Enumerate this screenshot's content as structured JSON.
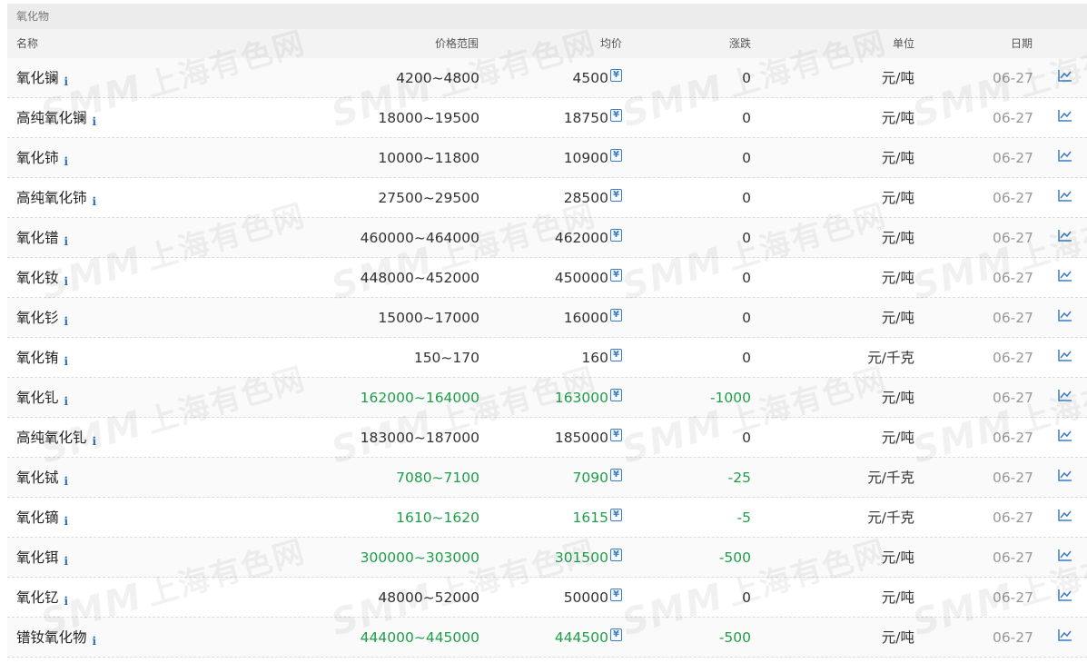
{
  "section_title": "氧化物",
  "columns": {
    "name": "名称",
    "range": "价格范围",
    "avg": "均价",
    "change": "涨跌",
    "unit": "单位",
    "date": "日期"
  },
  "icons": {
    "info": "info-icon",
    "avg": "yuan-calendar-icon",
    "chart": "line-chart-icon"
  },
  "colors": {
    "down": "#1e9e4a",
    "info": "#2a6db5"
  },
  "watermark": {
    "brand": "SMM",
    "text": "上海有色网"
  },
  "info_glyph": "i",
  "avg_glyph": "¥",
  "rows": [
    {
      "name": "氧化镧",
      "range": "4200~4800",
      "avg": "4500",
      "change": "0",
      "unit": "元/吨",
      "date": "06-27",
      "down": false
    },
    {
      "name": "高纯氧化镧",
      "range": "18000~19500",
      "avg": "18750",
      "change": "0",
      "unit": "元/吨",
      "date": "06-27",
      "down": false
    },
    {
      "name": "氧化铈",
      "range": "10000~11800",
      "avg": "10900",
      "change": "0",
      "unit": "元/吨",
      "date": "06-27",
      "down": false
    },
    {
      "name": "高纯氧化铈",
      "range": "27500~29500",
      "avg": "28500",
      "change": "0",
      "unit": "元/吨",
      "date": "06-27",
      "down": false
    },
    {
      "name": "氧化镨",
      "range": "460000~464000",
      "avg": "462000",
      "change": "0",
      "unit": "元/吨",
      "date": "06-27",
      "down": false
    },
    {
      "name": "氧化钕",
      "range": "448000~452000",
      "avg": "450000",
      "change": "0",
      "unit": "元/吨",
      "date": "06-27",
      "down": false
    },
    {
      "name": "氧化钐",
      "range": "15000~17000",
      "avg": "16000",
      "change": "0",
      "unit": "元/吨",
      "date": "06-27",
      "down": false
    },
    {
      "name": "氧化铕",
      "range": "150~170",
      "avg": "160",
      "change": "0",
      "unit": "元/千克",
      "date": "06-27",
      "down": false
    },
    {
      "name": "氧化钆",
      "range": "162000~164000",
      "avg": "163000",
      "change": "-1000",
      "unit": "元/吨",
      "date": "06-27",
      "down": true
    },
    {
      "name": "高纯氧化钆",
      "range": "183000~187000",
      "avg": "185000",
      "change": "0",
      "unit": "元/吨",
      "date": "06-27",
      "down": false
    },
    {
      "name": "氧化铽",
      "range": "7080~7100",
      "avg": "7090",
      "change": "-25",
      "unit": "元/千克",
      "date": "06-27",
      "down": true
    },
    {
      "name": "氧化镝",
      "range": "1610~1620",
      "avg": "1615",
      "change": "-5",
      "unit": "元/千克",
      "date": "06-27",
      "down": true
    },
    {
      "name": "氧化铒",
      "range": "300000~303000",
      "avg": "301500",
      "change": "-500",
      "unit": "元/吨",
      "date": "06-27",
      "down": true
    },
    {
      "name": "氧化钇",
      "range": "48000~52000",
      "avg": "50000",
      "change": "0",
      "unit": "元/吨",
      "date": "06-27",
      "down": false
    },
    {
      "name": "镨钕氧化物",
      "range": "444000~445000",
      "avg": "444500",
      "change": "-500",
      "unit": "元/吨",
      "date": "06-27",
      "down": true
    }
  ]
}
